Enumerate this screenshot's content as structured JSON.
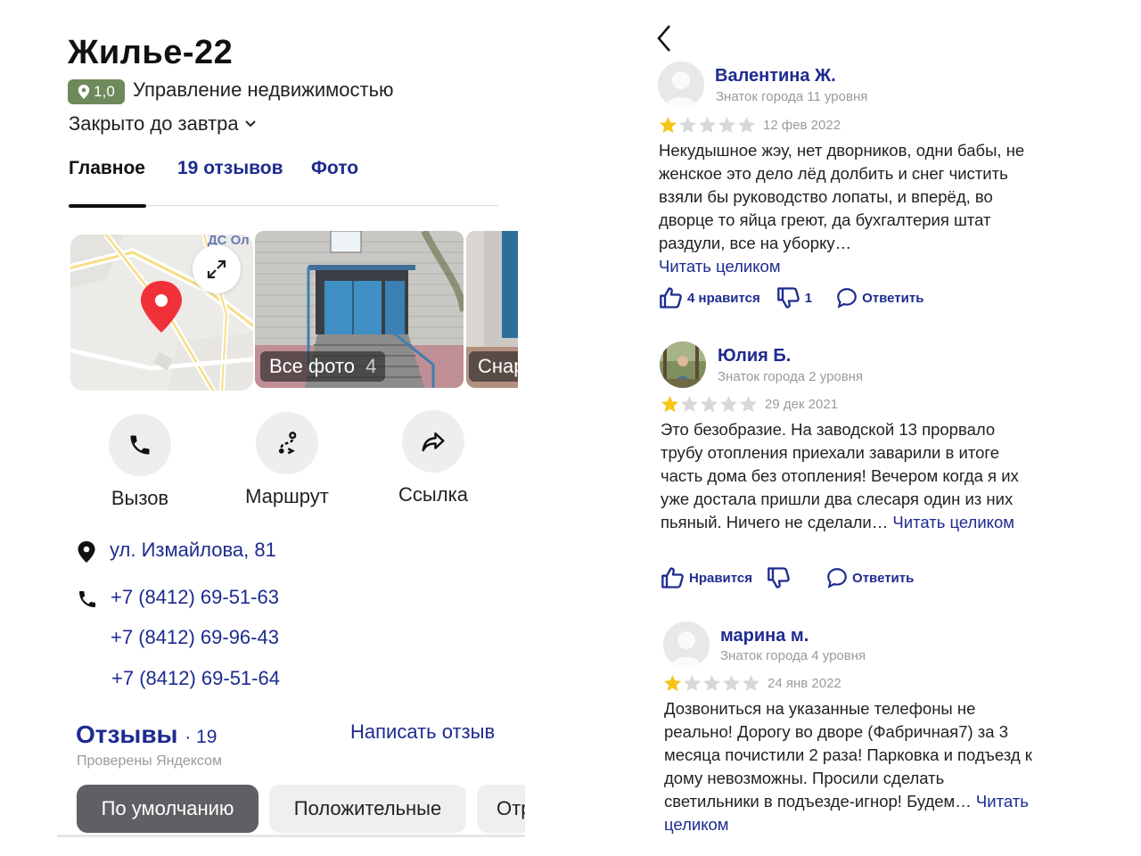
{
  "org": {
    "name": "Жилье-22",
    "rating": "1,0",
    "category": "Управление недвижимостью",
    "hours": "Закрыто до завтра"
  },
  "tabs": [
    {
      "label": "Главное",
      "active": true
    },
    {
      "label": "19 отзывов",
      "active": false
    },
    {
      "label": "Фото",
      "active": false
    }
  ],
  "media": {
    "map_label": "ДС Ол",
    "all_photos_label": "Все фото",
    "all_photos_count": "4",
    "next_photo_label": "Снар"
  },
  "actions": [
    {
      "label": "Вызов",
      "icon": "phone-icon"
    },
    {
      "label": "Маршрут",
      "icon": "route-icon"
    },
    {
      "label": "Ссылка",
      "icon": "share-icon"
    }
  ],
  "contacts": {
    "address": "ул. Измайлова, 81",
    "phones": [
      "+7 (8412) 69-51-63",
      "+7 (8412) 69-96-43",
      "+7 (8412) 69-51-64"
    ]
  },
  "reviews_section": {
    "title": "Отзывы",
    "count": "· 19",
    "verified": "Проверены Яндексом",
    "write_label": "Написать отзыв",
    "filters": [
      "По умолчанию",
      "Положительные",
      "Отр"
    ]
  },
  "reviews": [
    {
      "name": "Валентина Ж.",
      "level": "Знаток города 11 уровня",
      "rating": 1,
      "date": "12 фев 2022",
      "text": "Некудышное жэу, нет дворников, одни бабы, не женское это дело лёд долбить и снег чистить взяли бы руководство лопаты, и вперёд, во дворце то яйца греют, да бухгалтерия штат раздули, все на уборку…",
      "more": "Читать целиком",
      "likes": "4 нравится",
      "dislikes": "1",
      "reply": "Ответить"
    },
    {
      "name": "Юлия Б.",
      "level": "Знаток города 2 уровня",
      "rating": 1,
      "date": "29 дек 2021",
      "text": "Это безобразие. На заводской 13 прорвало трубу отопления приехали заварили в итоге часть дома без отопления! Вечером когда я их уже достала пришли два слесаря один из них пьяный. Ничего не сделали…",
      "more": "Читать целиком",
      "likes": "Нравится",
      "dislikes": "",
      "reply": "Ответить"
    },
    {
      "name": "марина м.",
      "level": "Знаток города 4 уровня",
      "rating": 1,
      "date": "24 янв 2022",
      "text": "Дозвониться на указанные телефоны не реально! Дорогу во дворе (Фабричная7) за 3 месяца почистили 2 раза! Парковка и подъезд к дому невозможны. Просили сделать светильники в подъезде-игнор! Будем…",
      "more": "Читать целиком"
    }
  ],
  "colors": {
    "link": "#1d2b8f",
    "rating_badge": "#6f8a5a",
    "star_filled": "#f5c518",
    "star_empty": "#d8d8d8",
    "chip_active": "#5f6063"
  }
}
